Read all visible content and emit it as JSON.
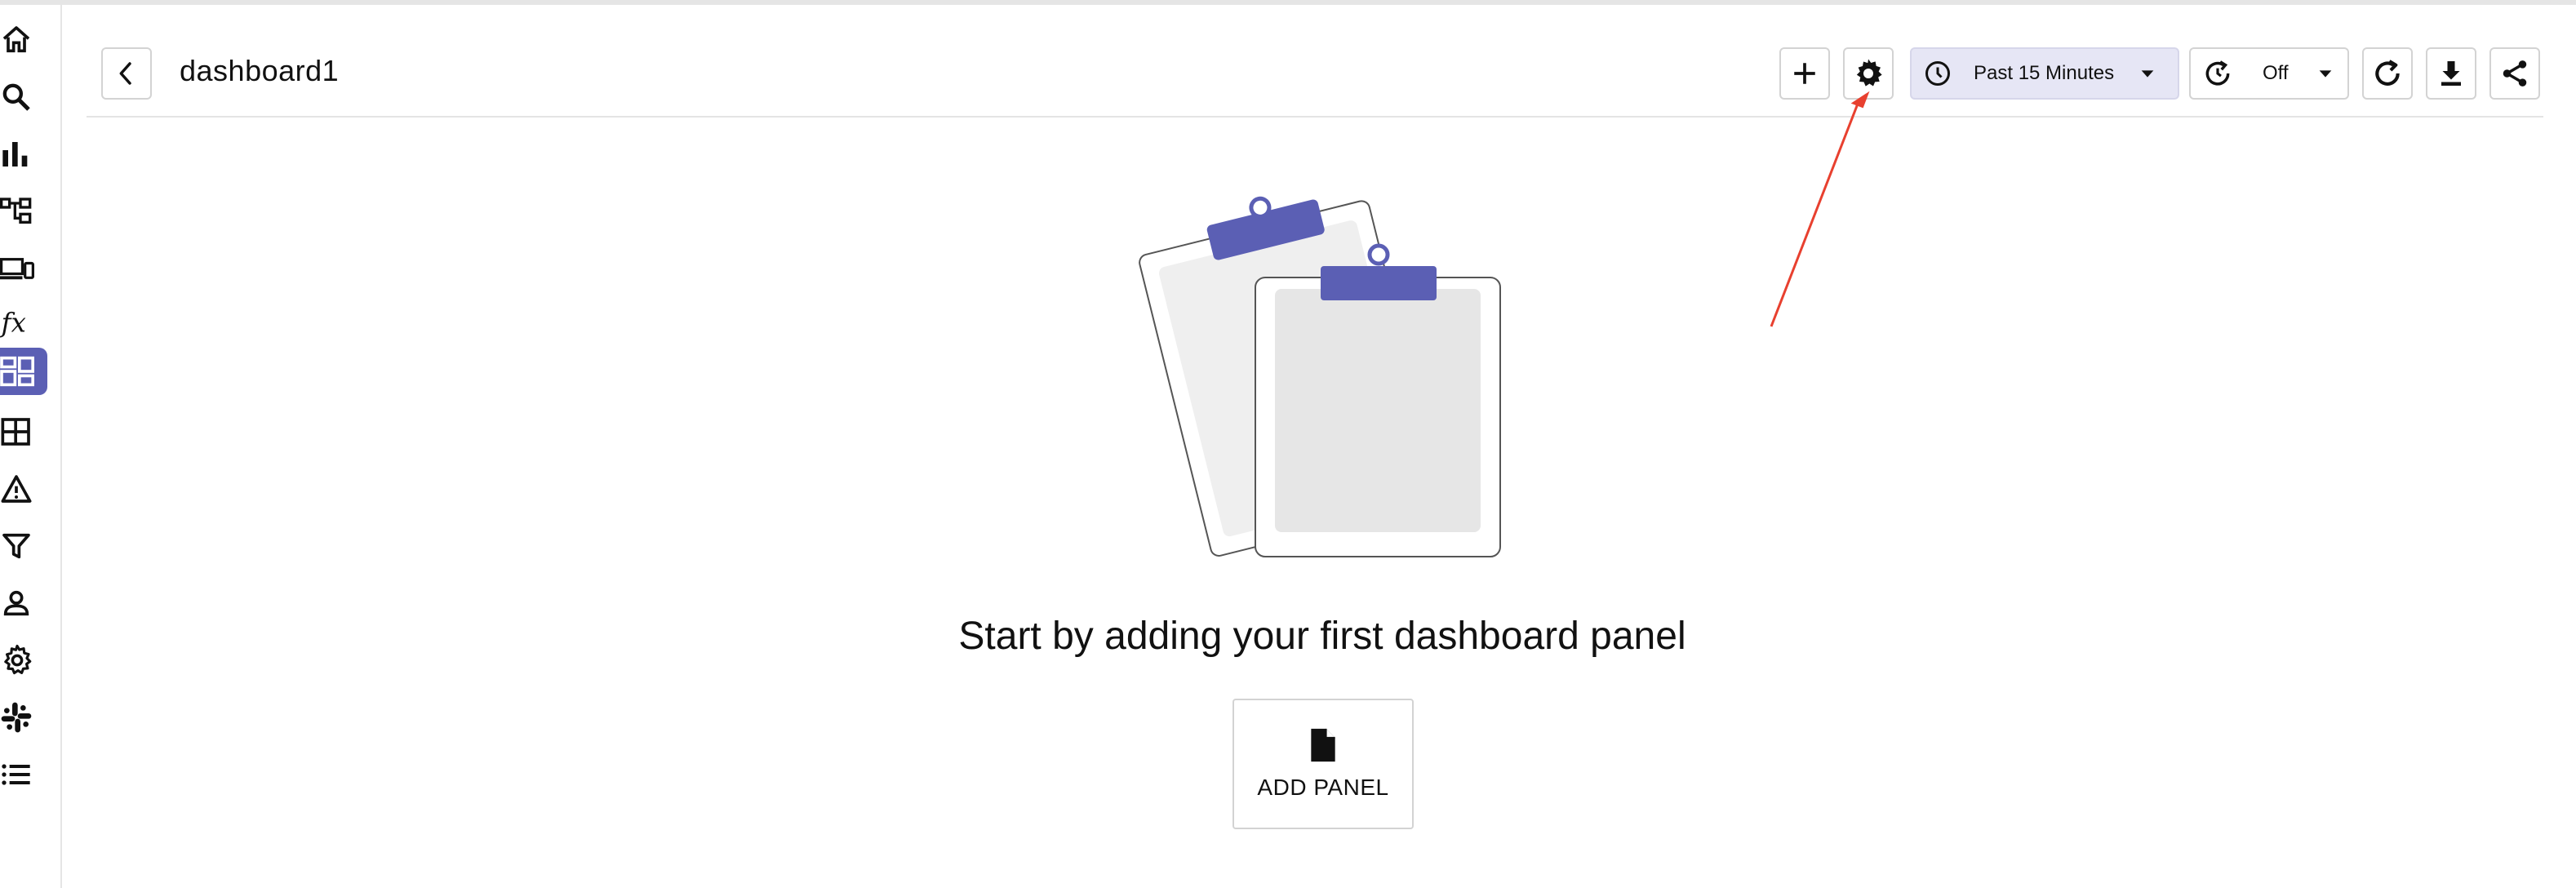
{
  "header": {
    "title": "dashboard1"
  },
  "toolbar": {
    "time_range_label": "Past 15 Minutes",
    "refresh_label": "Off"
  },
  "sidebar": {
    "items": [
      {
        "icon": "home-icon",
        "active": false
      },
      {
        "icon": "search-icon",
        "active": false
      },
      {
        "icon": "bar-chart-icon",
        "active": false
      },
      {
        "icon": "hierarchy-icon",
        "active": false
      },
      {
        "icon": "devices-icon",
        "active": false
      },
      {
        "icon": "function-icon",
        "active": false
      },
      {
        "icon": "dashboard-icon",
        "active": true
      },
      {
        "icon": "table-icon",
        "active": false
      },
      {
        "icon": "alert-icon",
        "active": false
      },
      {
        "icon": "filter-icon",
        "active": false
      },
      {
        "icon": "user-icon",
        "active": false
      },
      {
        "icon": "gear-icon",
        "active": false
      },
      {
        "icon": "slack-icon",
        "active": false
      },
      {
        "icon": "list-icon",
        "active": false
      }
    ]
  },
  "empty_state": {
    "message": "Start by adding your first dashboard panel",
    "add_panel_label": "ADD PANEL"
  },
  "colors": {
    "accent": "#5b5fb4",
    "annotation": "#e8402f",
    "time_picker_bg": "#e6e6f5"
  }
}
